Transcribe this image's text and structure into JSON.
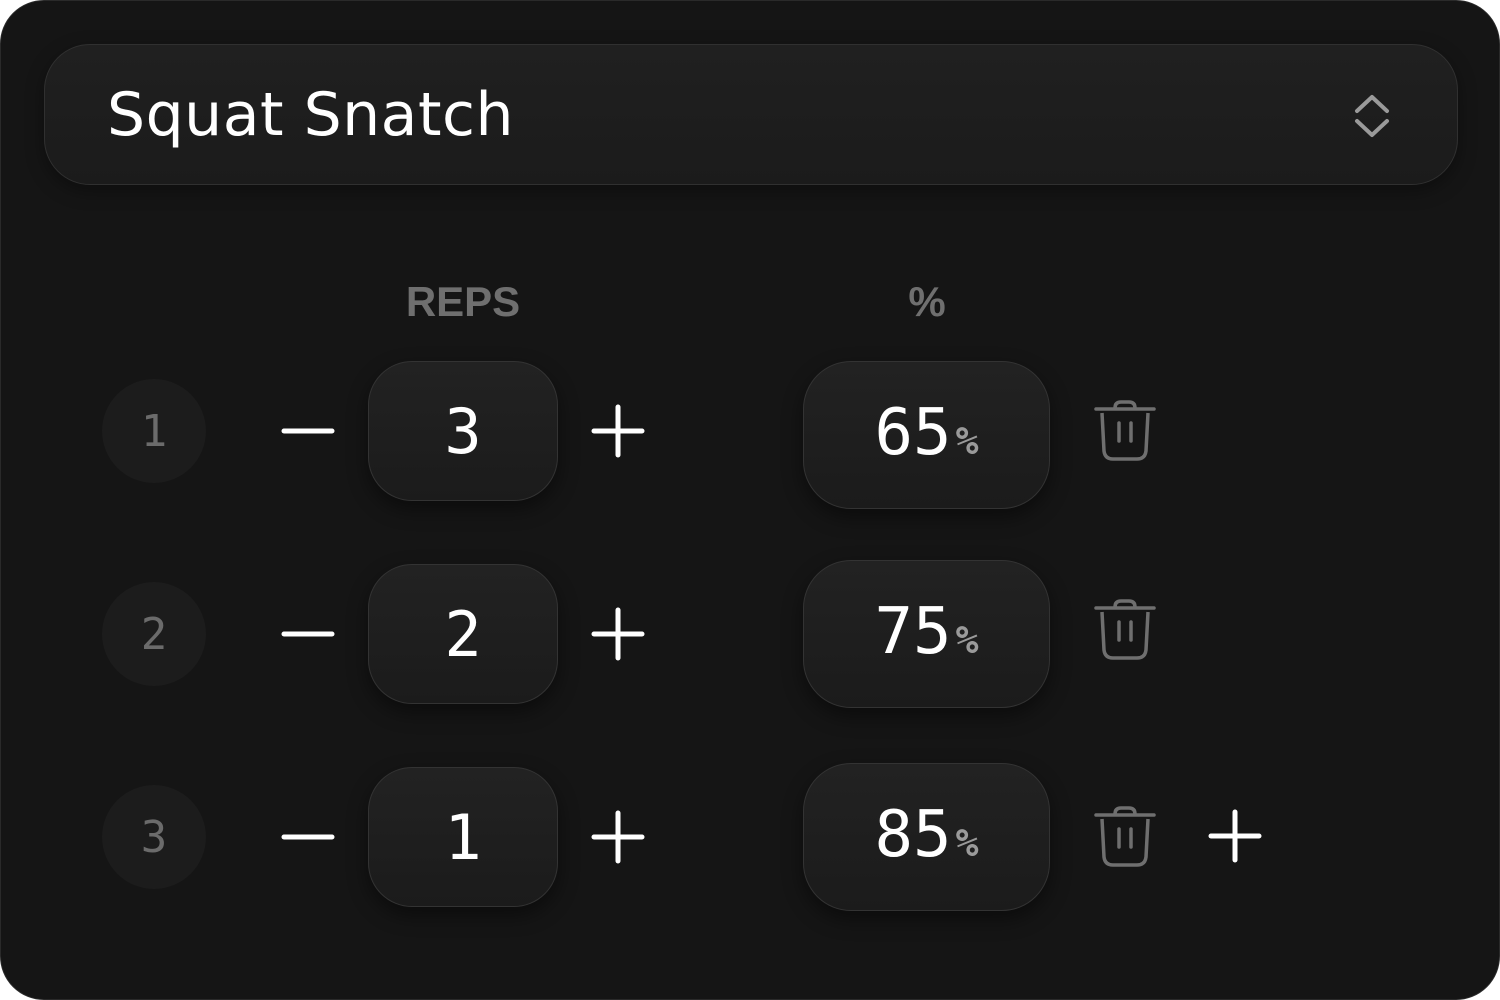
{
  "exercise": {
    "selected": "Squat Snatch",
    "chevron_icon": "chevron-up-down-icon"
  },
  "headers": {
    "reps": "REPS",
    "percent": "%"
  },
  "sets": [
    {
      "number": "1",
      "reps": "3",
      "percent": "65",
      "unit": "%"
    },
    {
      "number": "2",
      "reps": "2",
      "percent": "75",
      "unit": "%"
    },
    {
      "number": "3",
      "reps": "1",
      "percent": "85",
      "unit": "%"
    }
  ],
  "icons": {
    "decrement": "minus-icon",
    "increment": "plus-icon",
    "delete": "trash-icon",
    "add_set": "plus-icon"
  },
  "colors": {
    "background": "#151515",
    "surface": "#1e1e1e",
    "text": "#ffffff",
    "muted": "#6f6f6f"
  }
}
